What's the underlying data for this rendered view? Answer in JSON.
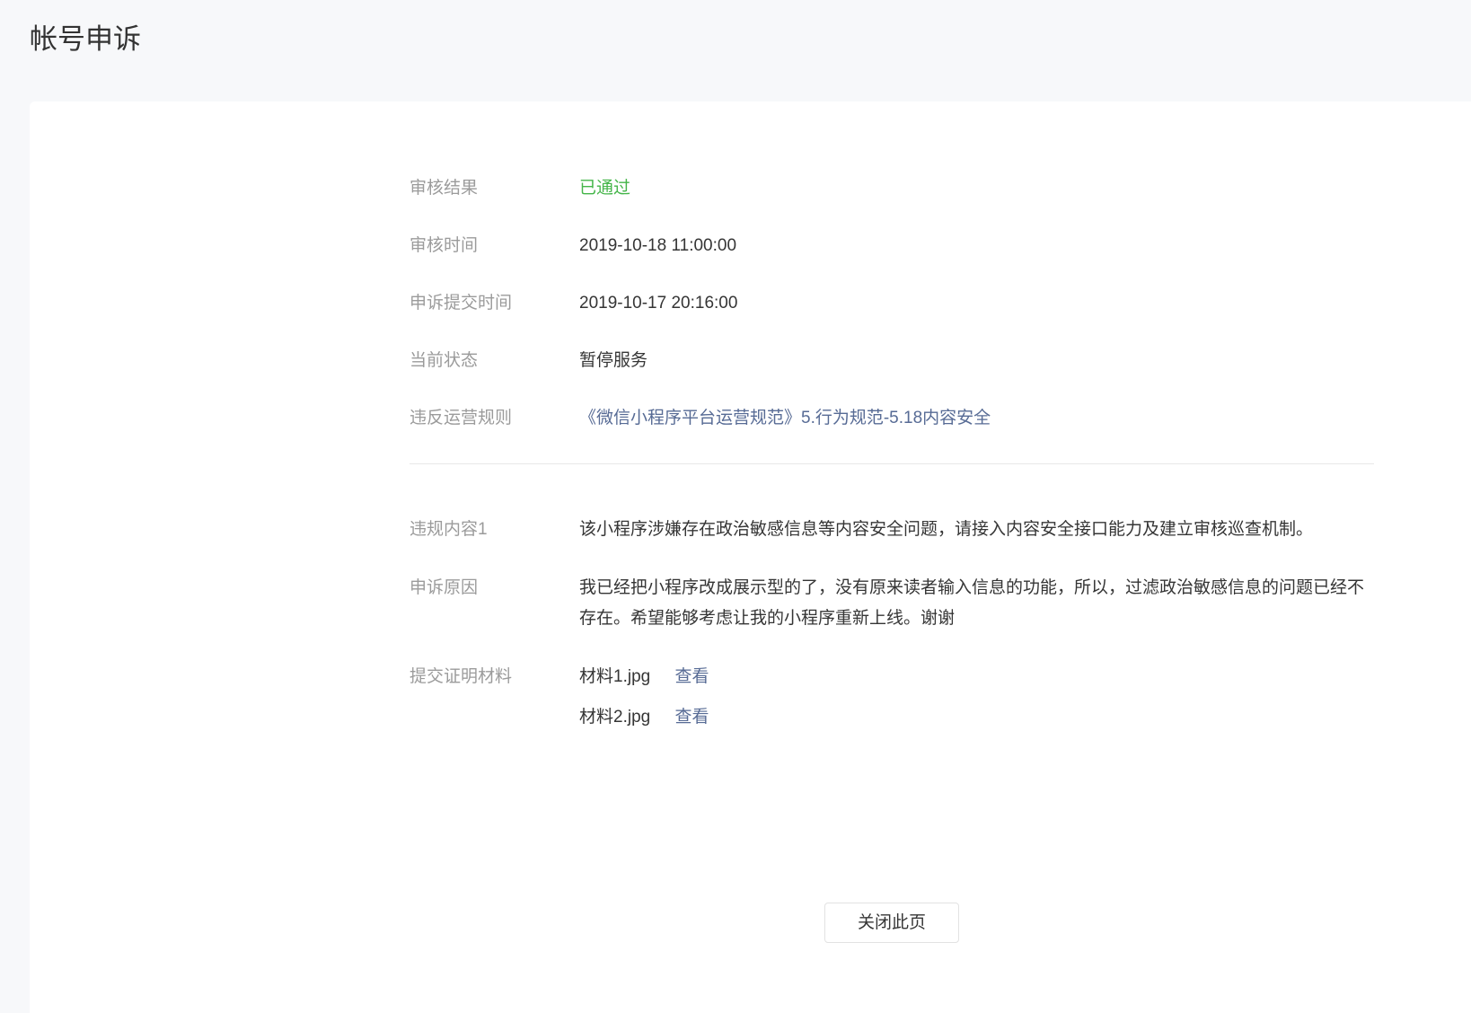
{
  "page": {
    "title": "帐号申诉"
  },
  "colors": {
    "background": "#f7f8fa",
    "card": "#ffffff",
    "label_gray": "#9b9b9b",
    "text": "#353535",
    "success_green": "#44b549",
    "link_blue": "#576b95",
    "divider": "#e7e7e7",
    "button_border": "#e2e2e2"
  },
  "form": {
    "rows": [
      {
        "label": "审核结果",
        "value": "已通过"
      },
      {
        "label": "审核时间",
        "value": "2019-10-18 11:00:00"
      },
      {
        "label": "申诉提交时间",
        "value": "2019-10-17 20:16:00"
      },
      {
        "label": "当前状态",
        "value": "暂停服务"
      },
      {
        "label": "违反运营规则",
        "value": "《微信小程序平台运营规范》5.行为规范-5.18内容安全"
      }
    ],
    "detail_rows": [
      {
        "label": "违规内容1",
        "value": "该小程序涉嫌存在政治敏感信息等内容安全问题，请接入内容安全接口能力及建立审核巡查机制。"
      },
      {
        "label": "申诉原因",
        "value": "我已经把小程序改成展示型的了，没有原来读者输入信息的功能，所以，过滤政治敏感信息的问题已经不存在。希望能够考虑让我的小程序重新上线。谢谢"
      }
    ],
    "materials": {
      "label": "提交证明材料",
      "files": [
        {
          "name": "材料1.jpg",
          "action": "查看"
        },
        {
          "name": "材料2.jpg",
          "action": "查看"
        }
      ]
    },
    "close_button_label": "关闭此页"
  }
}
